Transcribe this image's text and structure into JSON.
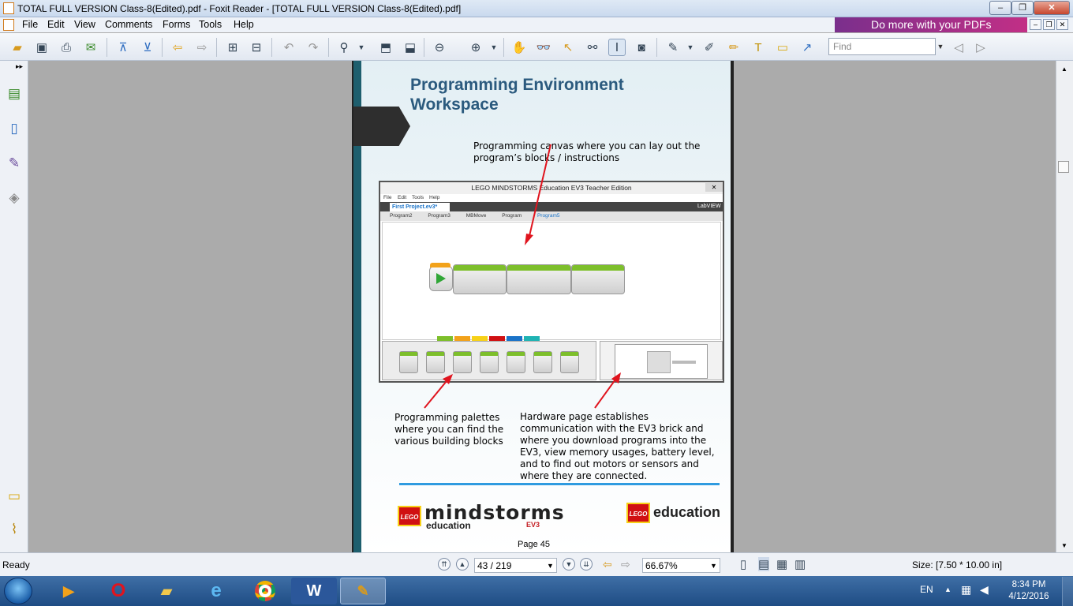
{
  "window": {
    "title": "TOTAL FULL VERSION Class-8(Edited).pdf - Foxit Reader - [TOTAL FULL VERSION Class-8(Edited).pdf]",
    "minimize": "–",
    "restore": "❐",
    "close": "✕"
  },
  "menu": {
    "items": [
      "File",
      "Edit",
      "View",
      "Comments",
      "Forms",
      "Tools",
      "Help"
    ],
    "ad": "Do more with your PDFs"
  },
  "toolbar": {
    "find_placeholder": "Find"
  },
  "page": {
    "title": "Programming Environment Workspace",
    "note_canvas": "Programming canvas where you can lay out the program’s blocks / instructions",
    "note_palettes": "Programming palettes where you can find the various building blocks",
    "note_hardware": "Hardware page establishes communication with the EV3 brick and where you download programs into the EV3, view memory usages, battery level, and to find out motors or sensors and where they are connected.",
    "page_label": "Page 45",
    "logo_mindstorms": "mindstorms",
    "logo_education_small": "education",
    "logo_ev3": "EV3",
    "logo_lego": "LEGO",
    "logo_education": "education"
  },
  "ev3": {
    "title": "LEGO MINDSTORMS Education EV3 Teacher Edition",
    "menu": [
      "File",
      "Edit",
      "Tools",
      "Help"
    ],
    "project_tab": "First Project.ev3*",
    "programs": [
      "Program2",
      "Program3",
      "MBMove",
      "Program",
      "Program5"
    ],
    "labview": "LabVIEW"
  },
  "status": {
    "ready": "Ready",
    "page_value": "43 / 219",
    "zoom_value": "66.67%",
    "size": "Size: [7.50 * 10.00 in]"
  },
  "taskbar": {
    "lang": "EN",
    "time": "8:34 PM",
    "date": "4/12/2016"
  },
  "colors": {
    "title_blue": "#2b5a7e",
    "divider": "#2f9be0",
    "lego_red": "#d01012",
    "taskbar": "#1e4c84"
  }
}
